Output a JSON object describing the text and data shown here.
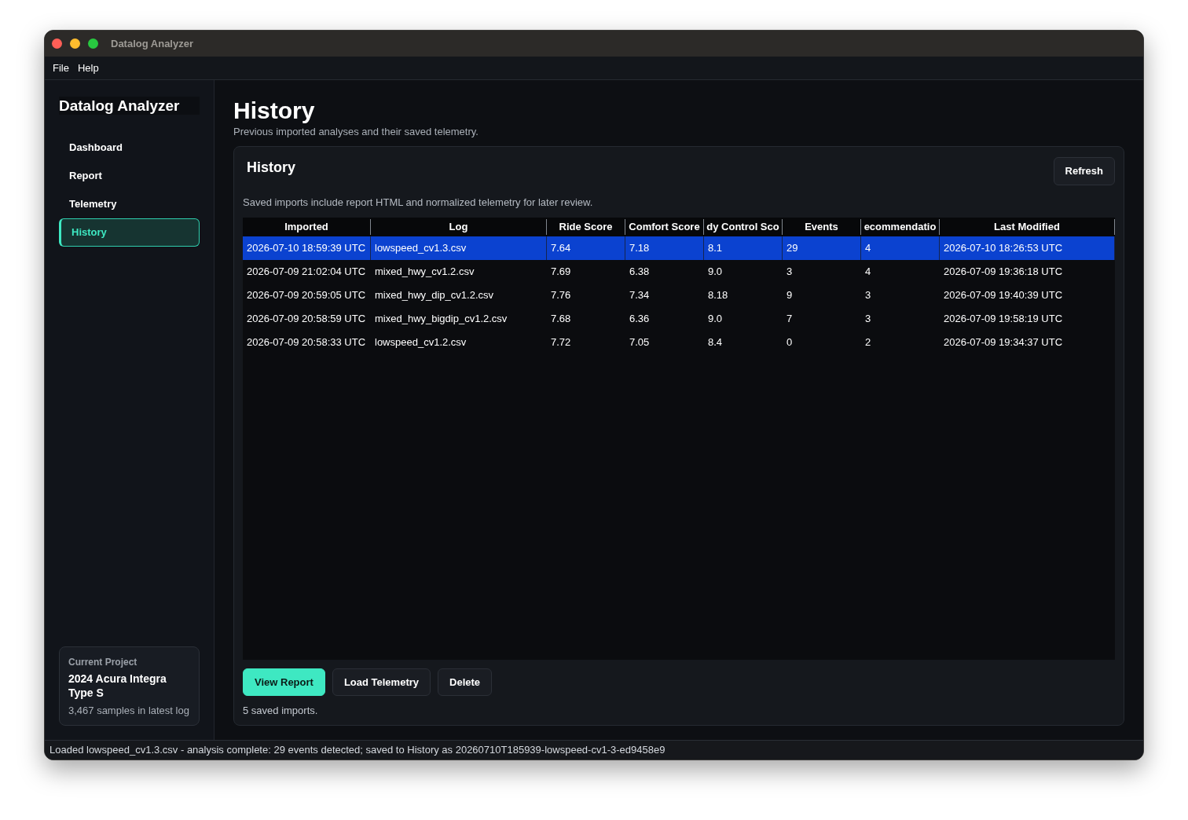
{
  "window": {
    "title": "Datalog Analyzer"
  },
  "menu": [
    "File",
    "Help"
  ],
  "sidebar": {
    "app_name": "Datalog Analyzer",
    "items": [
      {
        "label": "Dashboard",
        "selected": false
      },
      {
        "label": "Report",
        "selected": false
      },
      {
        "label": "Telemetry",
        "selected": false
      },
      {
        "label": "History",
        "selected": true
      }
    ],
    "project_card": {
      "heading": "Current Project",
      "name": "2024 Acura Integra Type S",
      "detail": "3,467 samples in latest log"
    }
  },
  "page": {
    "title": "History",
    "subtitle": "Previous imported analyses and their saved telemetry."
  },
  "panel": {
    "title": "History",
    "refresh_button": "Refresh",
    "description": "Saved imports include report HTML and normalized telemetry for later review.",
    "table": {
      "columns": [
        "Imported",
        "Log",
        "Ride Score",
        "Comfort Score",
        "dy Control Sco",
        "Events",
        "ecommendatio",
        "Last Modified"
      ],
      "rows": [
        {
          "selected": true,
          "cells": [
            "2026-07-10 18:59:39 UTC",
            "lowspeed_cv1.3.csv",
            "7.64",
            "7.18",
            "8.1",
            "29",
            "4",
            "2026-07-10 18:26:53 UTC"
          ]
        },
        {
          "selected": false,
          "cells": [
            "2026-07-09 21:02:04 UTC",
            "mixed_hwy_cv1.2.csv",
            "7.69",
            "6.38",
            "9.0",
            "3",
            "4",
            "2026-07-09 19:36:18 UTC"
          ]
        },
        {
          "selected": false,
          "cells": [
            "2026-07-09 20:59:05 UTC",
            "mixed_hwy_dip_cv1.2.csv",
            "7.76",
            "7.34",
            "8.18",
            "9",
            "3",
            "2026-07-09 19:40:39 UTC"
          ]
        },
        {
          "selected": false,
          "cells": [
            "2026-07-09 20:58:59 UTC",
            "mixed_hwy_bigdip_cv1.2.csv",
            "7.68",
            "6.36",
            "9.0",
            "7",
            "3",
            "2026-07-09 19:58:19 UTC"
          ]
        },
        {
          "selected": false,
          "cells": [
            "2026-07-09 20:58:33 UTC",
            "lowspeed_cv1.2.csv",
            "7.72",
            "7.05",
            "8.4",
            "0",
            "2",
            "2026-07-09 19:34:37 UTC"
          ]
        }
      ]
    },
    "buttons": [
      {
        "label": "View Report",
        "kind": "primary"
      },
      {
        "label": "Load Telemetry",
        "kind": "secondary"
      },
      {
        "label": "Delete",
        "kind": "secondary"
      }
    ],
    "count_text": "5 saved imports."
  },
  "status_bar": "Loaded lowspeed_cv1.3.csv - analysis complete: 29 events detected; saved to History as 20260710T185939-lowspeed-cv1-3-ed9458e9"
}
